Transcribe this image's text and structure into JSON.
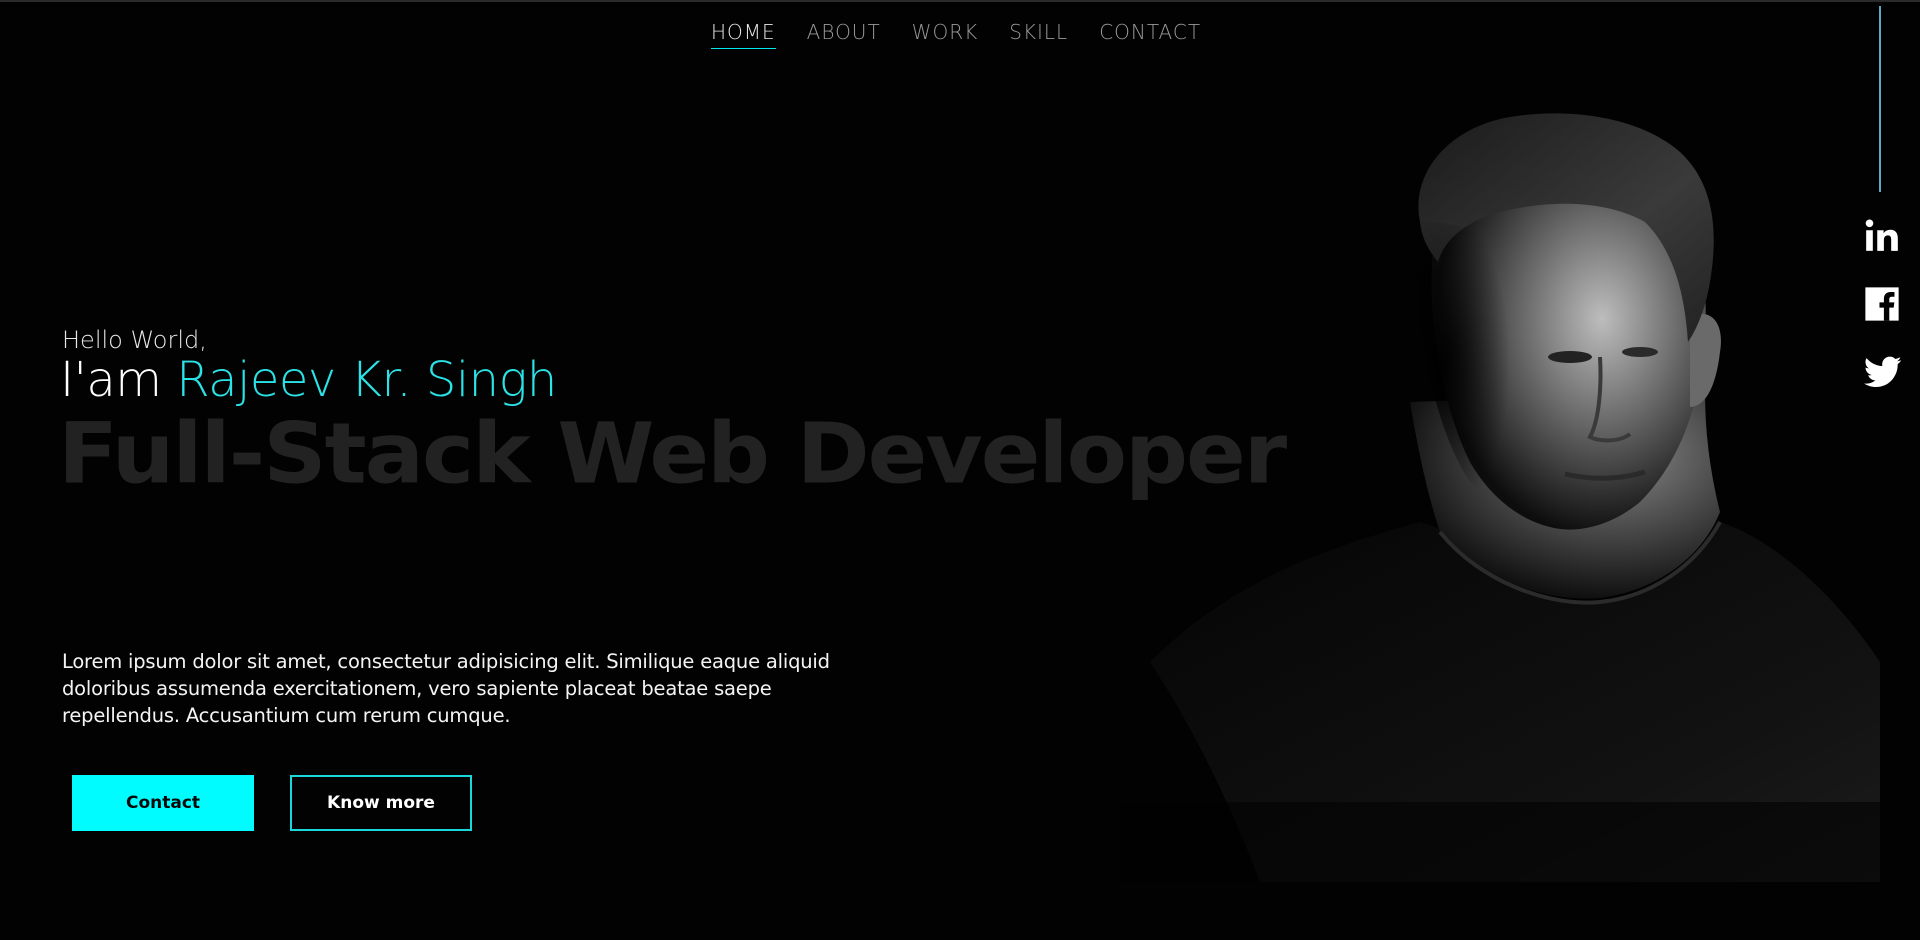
{
  "nav": {
    "items": [
      {
        "label": "HOME",
        "active": true
      },
      {
        "label": "ABOUT",
        "active": false
      },
      {
        "label": "WORK",
        "active": false
      },
      {
        "label": "SKILL",
        "active": false
      },
      {
        "label": "CONTACT",
        "active": false
      }
    ]
  },
  "hero": {
    "greeting": "Hello World,",
    "intro_prefix": "I'am ",
    "name": "Rajeev Kr. Singh",
    "role": "Full-Stack Web Developer",
    "description": "Lorem ipsum dolor sit amet, consectetur adipisicing elit. Similique eaque aliquid doloribus assumenda exercitationem, vero sapiente placeat beatae saepe repellendus. Accusantium cum rerum cumque.",
    "contact_button": "Contact",
    "more_button": "Know more"
  },
  "social": {
    "icons": [
      "linkedin-icon",
      "facebook-icon",
      "twitter-icon"
    ]
  },
  "colors": {
    "accent": "#00fcff",
    "name": "#2be3e6",
    "background": "#020202",
    "role_text": "#222222",
    "side_line": "#5fa7c4"
  }
}
